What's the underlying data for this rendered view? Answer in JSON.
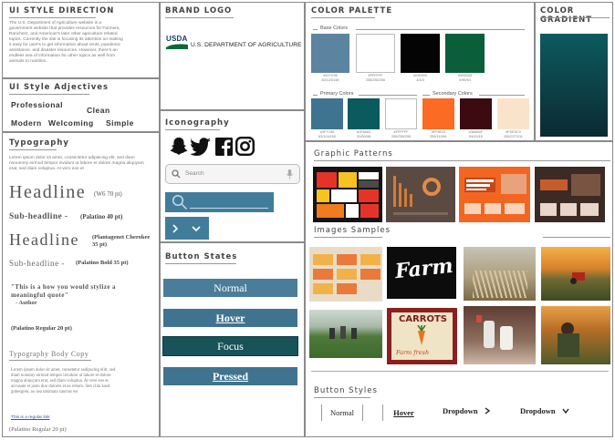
{
  "style_direction": {
    "title": "UI STYLE DIRECTION",
    "text": "The U.S. Department of Agriculture website is a government website that provides resources for Farmers, Ranchers, and American's later other agriculture related topics. Currently the site is focusing its attention on making it easy for user's to get information about rents, pandemic assistance, and disaster resources. However, there's an endless sea of information for other topics as well from animals to nutrition."
  },
  "adjectives": {
    "title": "UI Style Adjectives",
    "words": [
      "Professional",
      "Clean",
      "Modern",
      "Welcoming",
      "Simple"
    ]
  },
  "typography": {
    "title": "Typography",
    "lorem": "Lorem ipsum dolor sit amet, consectetur adipiscing elit, sed diam nonummy eirmod tempor invidunt ut labore et dolore magna aliquyam erat, sed diam voluptua. At vero eos et",
    "headline1": "Headline",
    "headline1_note": "(W6 70 pt)",
    "subheadline1": "Sub-headline -",
    "subheadline1_note": "(Palatino 40 pt)",
    "headline2": "Headline",
    "headline2_note": "(Plantagenet Cherokee 35 pt)",
    "subheadline2": "Sub-headline -",
    "subheadline2_note": "(Palatino Bold 35 pt)",
    "quote": "\"This is a how you would stylize a meaningful quote\"",
    "quote_author": "- Author",
    "quote_note": "(Palatino Regular 20 pt)",
    "body_title": "Typography Body Copy",
    "body_text": "Lorem ipsum dolor sit amet, consetetur sadipscing elitr, sed diam nonumy eirmod tempor invidunt ut labore et dolore magna aliquyam erat, sed diam voluptua. At vero eos et accusam et justo duo dolores et ea rebum. Stet clita kasd gubergren, no sea takimata sanctus est",
    "link_text": "This is a regular link",
    "body_note": "(Palatino Regular 20 pt)"
  },
  "brand_logo": {
    "title": "BRAND LOGO",
    "logo_mark": "USDA",
    "logo_text": "U.S. DEPARTMENT OF AGRICULTURE"
  },
  "iconography": {
    "title": "Iconography",
    "icons": [
      "snapchat-icon",
      "twitter-icon",
      "facebook-icon",
      "instagram-icon"
    ],
    "search_placeholder": "Search"
  },
  "button_states": {
    "title": "Button States",
    "normal": "Normal",
    "hover": "Hover",
    "focus": "Focus",
    "pressed": "Pressed"
  },
  "color_palette": {
    "title": "COLOR PALETTE",
    "base_label": "Base Colors",
    "base": [
      {
        "hex": "#5A84A0",
        "code": "#527C96",
        "rgb": "82/124/148"
      },
      {
        "hex": "#FFFFFF",
        "code": "#FFFFFF",
        "rgb": "255/255/255"
      },
      {
        "hex": "#040404",
        "code": "#030303",
        "rgb": "3/3/3"
      },
      {
        "hex": "#0B5E3A",
        "code": "#005A43",
        "rgb": "0/90/64"
      }
    ],
    "primary_label": "Primary Colors",
    "secondary_label": "Secondary Colors",
    "primary": [
      {
        "hex": "#3F7490",
        "code": "#3F7C96",
        "rgb": "63/124/150"
      },
      {
        "hex": "#0B5A5E",
        "code": "#1F5A62",
        "rgb": "31/90/98"
      },
      {
        "hex": "#FFFFFF",
        "code": "#FFFFFF",
        "rgb": "255/255/255"
      }
    ],
    "secondary": [
      {
        "hex": "#FB6B24",
        "code": "#FF6E23",
        "rgb": "255/110/61"
      },
      {
        "hex": "#3B0B11",
        "code": "#360B0F",
        "rgb": "54/10/15"
      },
      {
        "hex": "#F9E4C9",
        "code": "#FDE3C0",
        "rgb": "253/227/211"
      }
    ]
  },
  "color_gradient": {
    "title": "COLOR GRADIENT",
    "from": "#0D5A5E",
    "to": "#0B2A33"
  },
  "graphic_patterns": {
    "title": "Graphic Patterns"
  },
  "images_samples": {
    "title": "Images Samples",
    "farm_sign": "Farm",
    "carrots_sign": "CARROTS",
    "carrots_sub": "Farm fresh"
  },
  "button_styles": {
    "title": "Button Styles",
    "normal": "Normal",
    "hover": "Hover",
    "dropdown1": "Dropdown",
    "dropdown2": "Dropdown"
  }
}
